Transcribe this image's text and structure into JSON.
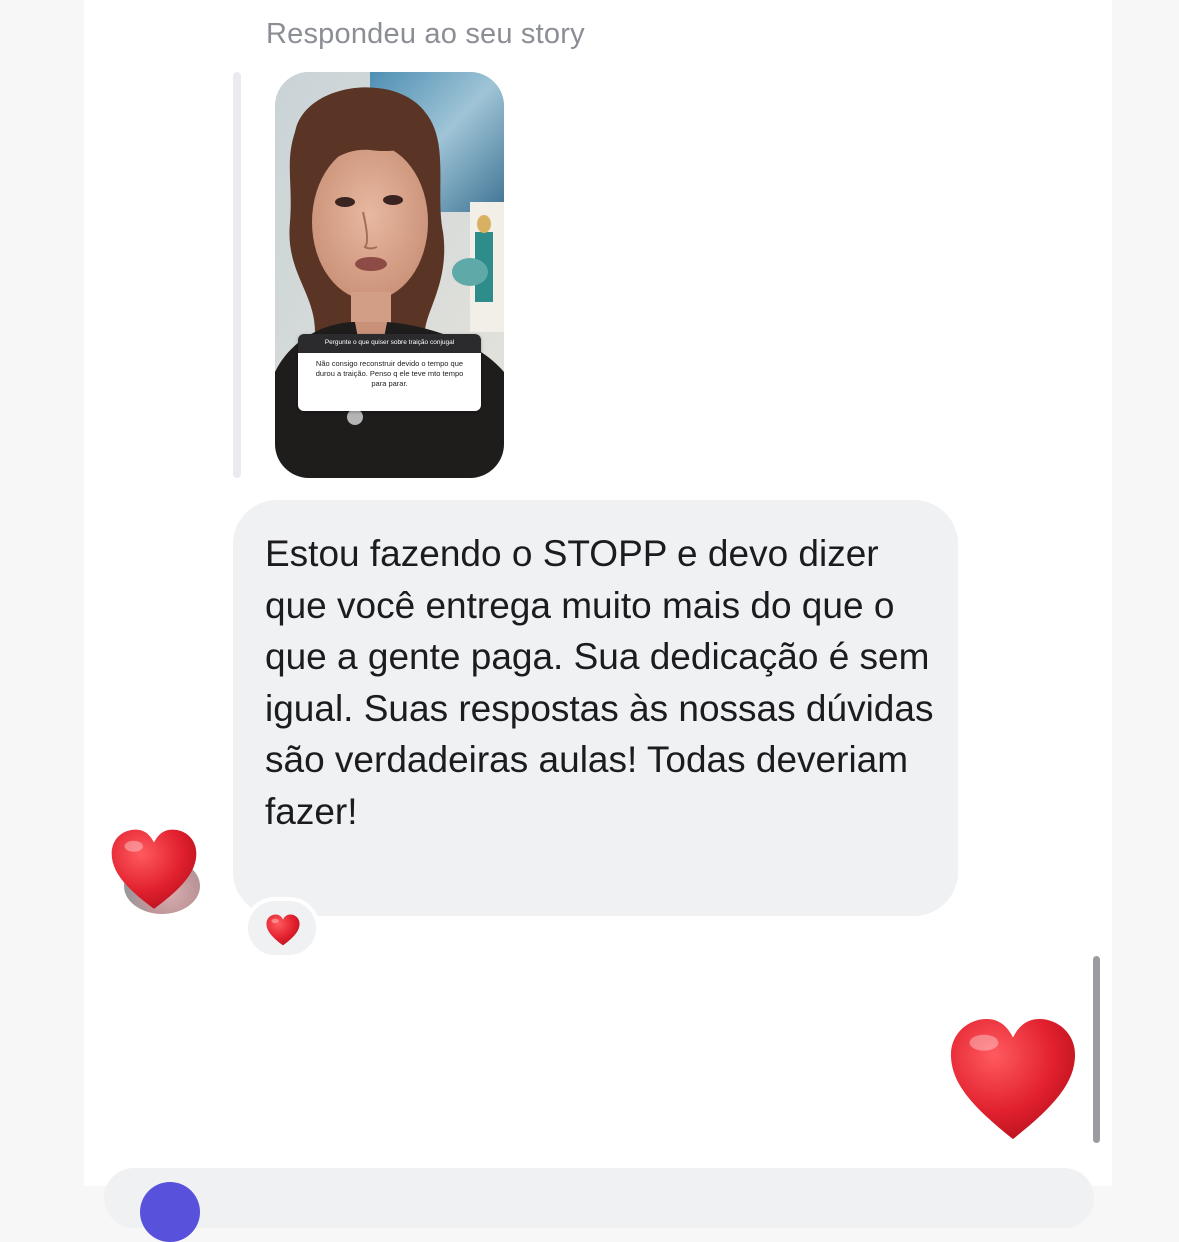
{
  "reply_caption": "Respondeu ao seu story",
  "story": {
    "sticker_question": "Pergunte o que quiser sobre traição conjugal",
    "sticker_answer": "Não consigo reconstruir devido o tempo que durou a traição. Penso q ele teve mto tempo para parar."
  },
  "message": {
    "text": "Estou fazendo o STOPP e devo dizer que você entrega muito mais do que o que a gente paga. Sua dedicação é sem igual. Suas respostas às nossas dúvidas são verdadeiras aulas! Todas deveriam fazer!",
    "reaction_icon": "red-heart-icon"
  },
  "sent_message": {
    "icon": "red-heart-icon"
  },
  "colors": {
    "heart": "#e1202e",
    "bubble": "#eff1f3",
    "caption": "#8b8e94",
    "text": "#1c1c1e"
  }
}
